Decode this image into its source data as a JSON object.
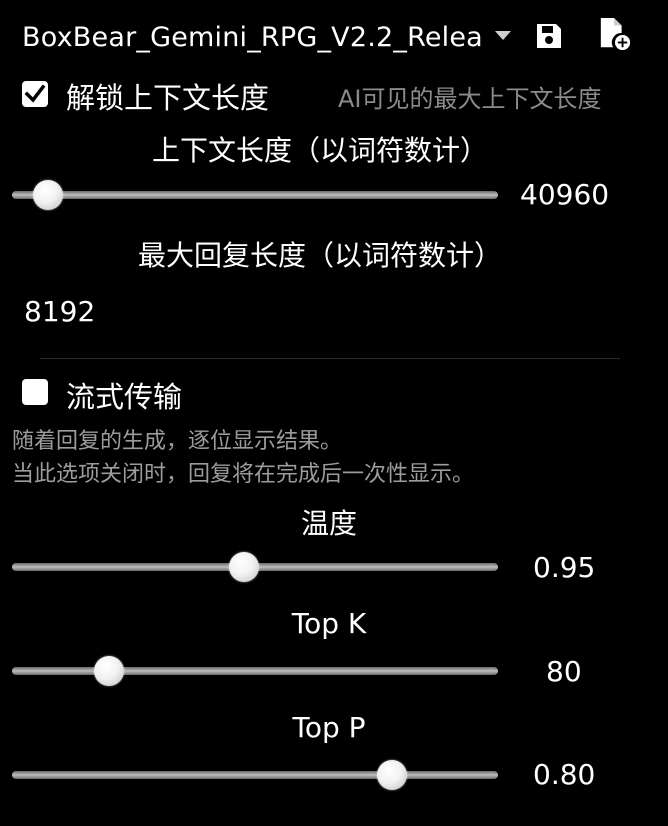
{
  "header": {
    "preset_name": "BoxBear_Gemini_RPG_V2.2_Relea",
    "icons": {
      "dropdown": "caret-down-icon",
      "save": "save-icon",
      "new_file": "file-add-icon"
    }
  },
  "context": {
    "unlock_label": "解锁上下文长度",
    "unlock_checked": true,
    "hint": "AI可见的最大上下文长度",
    "title": "上下文长度（以词符数计）",
    "value": "40960",
    "slider_fraction": 0.045
  },
  "response": {
    "title": "最大回复长度（以词符数计）",
    "value": "8192"
  },
  "streaming": {
    "label": "流式传输",
    "checked": false,
    "desc_line1": "随着回复的生成，逐位显示结果。",
    "desc_line2": "当此选项关闭时，回复将在完成后一次性显示。"
  },
  "temperature": {
    "title": "温度",
    "value": "0.95",
    "slider_fraction": 0.475
  },
  "top_k": {
    "title": "Top K",
    "value": "80",
    "slider_fraction": 0.18
  },
  "top_p": {
    "title": "Top P",
    "value": "0.80",
    "slider_fraction": 0.8
  }
}
